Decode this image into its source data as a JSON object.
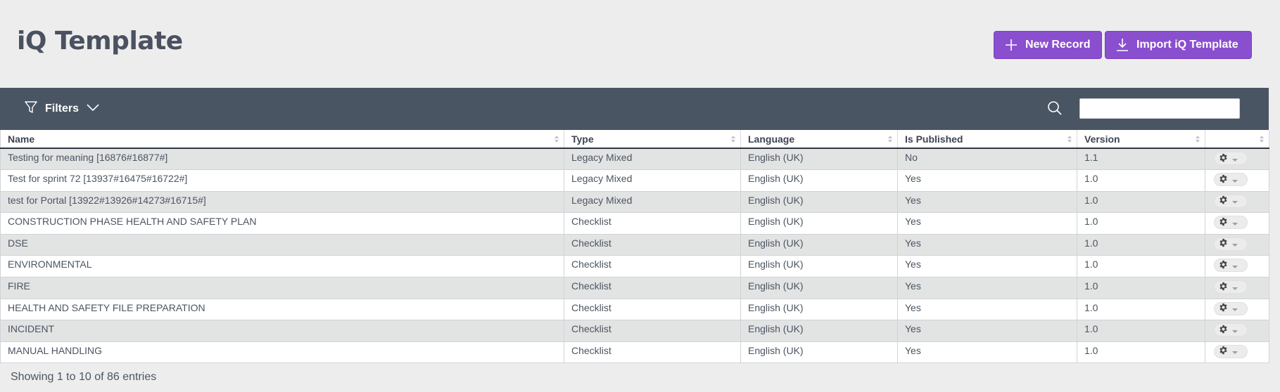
{
  "page": {
    "title": "iQ Template"
  },
  "actions": {
    "new_record": "New Record",
    "import": "Import iQ Template"
  },
  "toolbar": {
    "filters_label": "Filters",
    "search_value": ""
  },
  "table": {
    "columns": [
      "Name",
      "Type",
      "Language",
      "Is Published",
      "Version",
      ""
    ],
    "rows": [
      [
        "Testing for meaning [16876#16877#]",
        "Legacy Mixed",
        "English (UK)",
        "No",
        "1.1"
      ],
      [
        "Test for sprint 72 [13937#16475#16722#]",
        "Legacy Mixed",
        "English (UK)",
        "Yes",
        "1.0"
      ],
      [
        "test for Portal [13922#13926#14273#16715#]",
        "Legacy Mixed",
        "English (UK)",
        "Yes",
        "1.0"
      ],
      [
        "CONSTRUCTION PHASE HEALTH AND SAFETY PLAN",
        "Checklist",
        "English (UK)",
        "Yes",
        "1.0"
      ],
      [
        "DSE",
        "Checklist",
        "English (UK)",
        "Yes",
        "1.0"
      ],
      [
        "ENVIRONMENTAL",
        "Checklist",
        "English (UK)",
        "Yes",
        "1.0"
      ],
      [
        "FIRE",
        "Checklist",
        "English (UK)",
        "Yes",
        "1.0"
      ],
      [
        "HEALTH AND SAFETY FILE PREPARATION",
        "Checklist",
        "English (UK)",
        "Yes",
        "1.0"
      ],
      [
        "INCIDENT",
        "Checklist",
        "English (UK)",
        "Yes",
        "1.0"
      ],
      [
        "MANUAL HANDLING",
        "Checklist",
        "English (UK)",
        "Yes",
        "1.0"
      ]
    ],
    "row_actions_icon": "gear-icon"
  },
  "footer": {
    "info": "Showing 1 to 10 of 86 entries"
  },
  "colors": {
    "accent": "#8a4fcf",
    "toolbar": "#4a5564",
    "row_alt": "#e2e3e3"
  }
}
